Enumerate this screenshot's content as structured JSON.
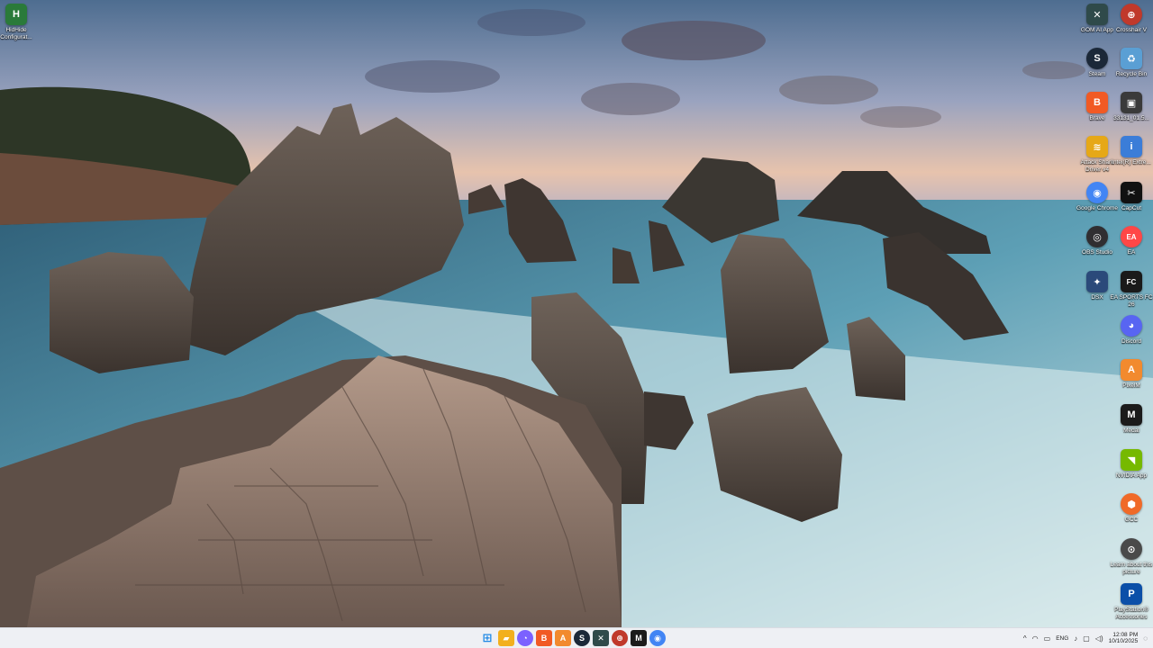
{
  "desktop": {
    "left_icons": [
      {
        "name": "hidhide-icon",
        "label": "HidHide Configurat...",
        "glyph": "H",
        "color": "#2a7a3a"
      }
    ],
    "right_icons": [
      {
        "name": "gom-ai-app-icon",
        "label": "GOM AI App",
        "glyph": "✕",
        "color": "#2f4a4a"
      },
      {
        "name": "crosshair-v-icon",
        "label": "Crosshair V",
        "glyph": "⊕",
        "color": "#c0392b"
      },
      {
        "name": "steam-icon",
        "label": "Steam",
        "glyph": "S",
        "color": "#1b2838"
      },
      {
        "name": "recycle-bin-icon",
        "label": "Recycle Bin",
        "glyph": "♻",
        "color": "#5a9fd4"
      },
      {
        "name": "brave-icon",
        "label": "Brave",
        "glyph": "B",
        "color": "#f15a24"
      },
      {
        "name": "image-file-icon",
        "label": "33131_01.5...",
        "glyph": "▣",
        "color": "#3a3a3a"
      },
      {
        "name": "attack-shark-icon",
        "label": "Attack Shark Driver v4",
        "glyph": "≋",
        "color": "#e6a817"
      },
      {
        "name": "intel-icon",
        "label": "Intel(R) Extre...",
        "glyph": "i",
        "color": "#3b7dd8"
      },
      {
        "name": "google-chrome-icon",
        "label": "Google Chrome",
        "glyph": "◉",
        "color": "#4285f4"
      },
      {
        "name": "capcut-icon",
        "label": "CapCut",
        "glyph": "✂",
        "color": "#111111"
      },
      {
        "name": "obs-studio-icon",
        "label": "OBS Studio",
        "glyph": "◎",
        "color": "#302e31"
      },
      {
        "name": "ea-icon",
        "label": "EA",
        "glyph": "EA",
        "color": "#ff4747"
      },
      {
        "name": "ds4-icon",
        "label": "DSX",
        "glyph": "✦",
        "color": "#2b4a7a"
      },
      {
        "name": "ea-sports-fc-icon",
        "label": "EA SPORTS FC 26",
        "glyph": "FC",
        "color": "#1a1a1a"
      },
      {
        "name": "discord-icon",
        "label": "Discord",
        "glyph": "◕",
        "color": "#5865f2"
      },
      {
        "name": "pixlr-icon",
        "label": "PixelM",
        "glyph": "A",
        "color": "#f28a2e"
      },
      {
        "name": "medal-icon",
        "label": "Medal",
        "glyph": "M",
        "color": "#1b1b1b"
      },
      {
        "name": "nvidia-app-icon",
        "label": "NVIDIA App",
        "glyph": "◥",
        "color": "#76b900"
      },
      {
        "name": "gcc-icon",
        "label": "GCC",
        "glyph": "⬢",
        "color": "#f06a28"
      },
      {
        "name": "learn-picture-icon",
        "label": "Learn about this picture",
        "glyph": "⊙",
        "color": "#4a4a4a"
      },
      {
        "name": "playstation-accessories-icon",
        "label": "PlayStation® Accessories",
        "glyph": "P",
        "color": "#0b4fa8"
      }
    ]
  },
  "taskbar": {
    "apps": [
      {
        "name": "start-button",
        "glyph": "⊞",
        "color": "#1e88e5"
      },
      {
        "name": "file-explorer-icon",
        "glyph": "▰",
        "color": "#f2b01e"
      },
      {
        "name": "copilot-icon",
        "glyph": "◔",
        "color": "#7b61ff"
      },
      {
        "name": "brave-taskbar-icon",
        "glyph": "B",
        "color": "#f15a24"
      },
      {
        "name": "pixelm-taskbar-icon",
        "glyph": "A",
        "color": "#f28a2e"
      },
      {
        "name": "steam-taskbar-icon",
        "glyph": "S",
        "color": "#1b2838"
      },
      {
        "name": "gom-taskbar-icon",
        "glyph": "✕",
        "color": "#2f4a4a"
      },
      {
        "name": "crosshair-taskbar-icon",
        "glyph": "⊕",
        "color": "#c0392b"
      },
      {
        "name": "medal-taskbar-icon",
        "glyph": "M",
        "color": "#1b1b1b"
      },
      {
        "name": "chrome-taskbar-icon",
        "glyph": "◉",
        "color": "#4285f4"
      }
    ],
    "tray": {
      "chevron": "^",
      "language": "ENG",
      "time": "12:08 PM",
      "date": "10/10/2025"
    }
  }
}
